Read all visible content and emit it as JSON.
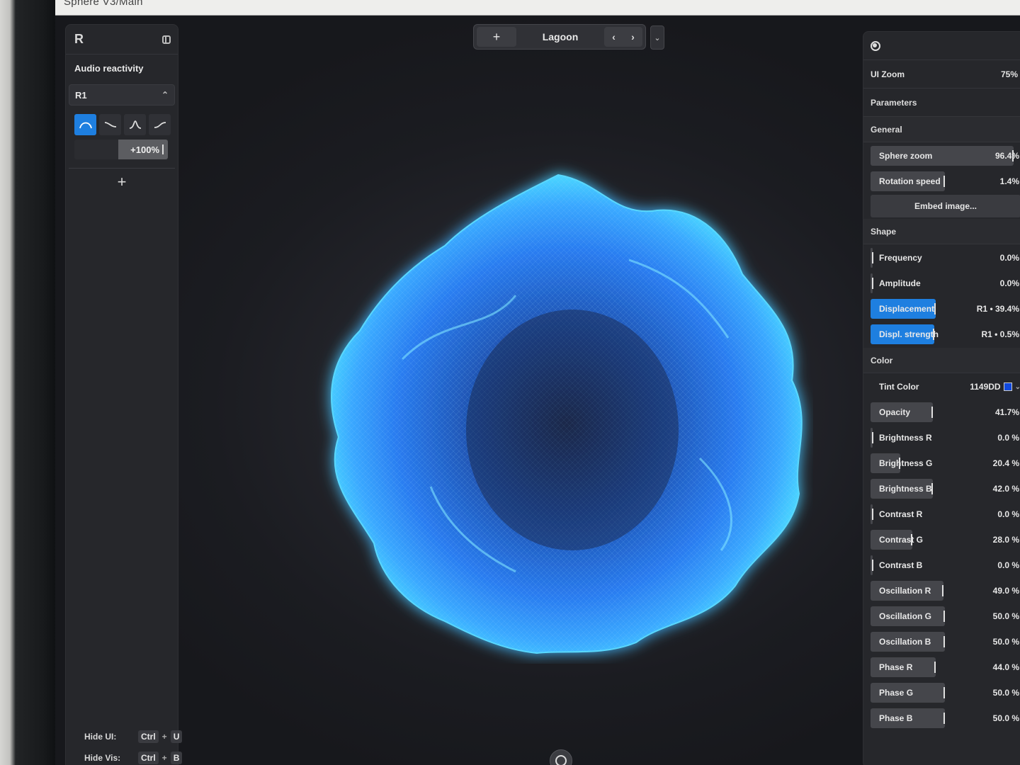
{
  "window": {
    "title": "Sphere V3/Main"
  },
  "left_panel": {
    "header": "R",
    "section_label": "Audio reactivity",
    "source_select": "R1",
    "curves": [
      "curve-bell",
      "curve-fall",
      "curve-peak",
      "curve-rise"
    ],
    "amount": "+100%",
    "add_label": "+",
    "shortcuts": [
      {
        "label": "Hide UI:",
        "mod": "Ctrl",
        "key": "U"
      },
      {
        "label": "Hide Vis:",
        "mod": "Ctrl",
        "key": "B"
      }
    ]
  },
  "top_bar": {
    "add_label": "+",
    "preset_name": "Lagoon",
    "prev": "‹",
    "next": "›",
    "dropdown": "⌄"
  },
  "right_panel": {
    "ui_zoom_label": "UI Zoom",
    "ui_zoom_value": "75%",
    "parameters_label": "Parameters",
    "general_label": "General",
    "general": [
      {
        "label": "Sphere zoom",
        "value": "96.4%",
        "fill": 0.96
      },
      {
        "label": "Rotation speed",
        "value": "1.4%",
        "fill": 0.5
      }
    ],
    "embed_label": "Embed image...",
    "shape_label": "Shape",
    "shape": [
      {
        "label": "Frequency",
        "value": "0.0%",
        "fill": 0.0,
        "accent": false
      },
      {
        "label": "Amplitude",
        "value": "0.0%",
        "fill": 0.0,
        "accent": false
      },
      {
        "label": "Displacement",
        "value": "R1 • 39.4%",
        "fill": 0.44,
        "accent": true
      },
      {
        "label": "Displ. strength",
        "value": "R1 • 0.5%",
        "fill": 0.43,
        "accent": true
      }
    ],
    "color_label": "Color",
    "tint": {
      "label": "Tint Color",
      "value": "1149DD",
      "color": "#1149DD"
    },
    "color": [
      {
        "label": "Opacity",
        "value": "41.7%",
        "fill": 0.42
      },
      {
        "label": "Brightness R",
        "value": "0.0 %",
        "fill": 0.0
      },
      {
        "label": "Brightness G",
        "value": "20.4 %",
        "fill": 0.2
      },
      {
        "label": "Brightness B",
        "value": "42.0 %",
        "fill": 0.42
      },
      {
        "label": "Contrast R",
        "value": "0.0 %",
        "fill": 0.0
      },
      {
        "label": "Contrast G",
        "value": "28.0 %",
        "fill": 0.28
      },
      {
        "label": "Contrast B",
        "value": "0.0 %",
        "fill": 0.0
      },
      {
        "label": "Oscillation R",
        "value": "49.0 %",
        "fill": 0.49
      },
      {
        "label": "Oscillation G",
        "value": "50.0 %",
        "fill": 0.5
      },
      {
        "label": "Oscillation B",
        "value": "50.0 %",
        "fill": 0.5
      },
      {
        "label": "Phase R",
        "value": "44.0 %",
        "fill": 0.44
      },
      {
        "label": "Phase G",
        "value": "50.0 %",
        "fill": 0.5
      },
      {
        "label": "Phase B",
        "value": "50.0 %",
        "fill": 0.5
      }
    ]
  },
  "colors": {
    "accent": "#1e7fe0",
    "sphere": "#2f8dff",
    "sphere_glow": "#4ad6ff"
  }
}
